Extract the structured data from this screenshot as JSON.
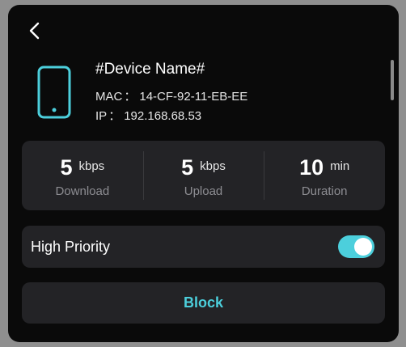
{
  "device": {
    "name": "#Device Name#",
    "mac_label": "MAC",
    "mac_value": "14-CF-92-11-EB-EE",
    "ip_label": "IP",
    "ip_value": "192.168.68.53",
    "separator": "："
  },
  "stats": [
    {
      "value": "5",
      "unit": "kbps",
      "label": "Download"
    },
    {
      "value": "5",
      "unit": "kbps",
      "label": "Upload"
    },
    {
      "value": "10",
      "unit": "min",
      "label": "Duration"
    }
  ],
  "priority": {
    "label": "High Priority",
    "enabled": true
  },
  "actions": {
    "block_label": "Block"
  },
  "colors": {
    "accent": "#4ccfdc",
    "background": "#0a0a0a",
    "card": "#232326",
    "muted_text": "#8d8d92"
  },
  "icons": {
    "back": "chevron-left-icon",
    "device": "phone-icon"
  }
}
